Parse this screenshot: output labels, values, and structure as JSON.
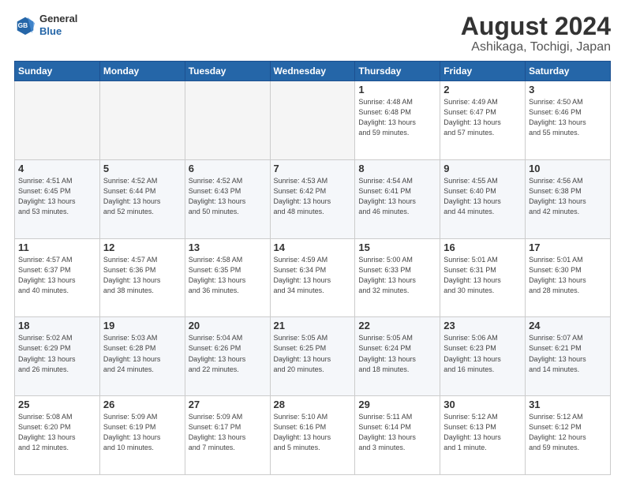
{
  "header": {
    "logo_general": "General",
    "logo_blue": "Blue",
    "title": "August 2024",
    "subtitle": "Ashikaga, Tochigi, Japan"
  },
  "days_of_week": [
    "Sunday",
    "Monday",
    "Tuesday",
    "Wednesday",
    "Thursday",
    "Friday",
    "Saturday"
  ],
  "weeks": [
    [
      {
        "day": "",
        "info": ""
      },
      {
        "day": "",
        "info": ""
      },
      {
        "day": "",
        "info": ""
      },
      {
        "day": "",
        "info": ""
      },
      {
        "day": "1",
        "info": "Sunrise: 4:48 AM\nSunset: 6:48 PM\nDaylight: 13 hours\nand 59 minutes."
      },
      {
        "day": "2",
        "info": "Sunrise: 4:49 AM\nSunset: 6:47 PM\nDaylight: 13 hours\nand 57 minutes."
      },
      {
        "day": "3",
        "info": "Sunrise: 4:50 AM\nSunset: 6:46 PM\nDaylight: 13 hours\nand 55 minutes."
      }
    ],
    [
      {
        "day": "4",
        "info": "Sunrise: 4:51 AM\nSunset: 6:45 PM\nDaylight: 13 hours\nand 53 minutes."
      },
      {
        "day": "5",
        "info": "Sunrise: 4:52 AM\nSunset: 6:44 PM\nDaylight: 13 hours\nand 52 minutes."
      },
      {
        "day": "6",
        "info": "Sunrise: 4:52 AM\nSunset: 6:43 PM\nDaylight: 13 hours\nand 50 minutes."
      },
      {
        "day": "7",
        "info": "Sunrise: 4:53 AM\nSunset: 6:42 PM\nDaylight: 13 hours\nand 48 minutes."
      },
      {
        "day": "8",
        "info": "Sunrise: 4:54 AM\nSunset: 6:41 PM\nDaylight: 13 hours\nand 46 minutes."
      },
      {
        "day": "9",
        "info": "Sunrise: 4:55 AM\nSunset: 6:40 PM\nDaylight: 13 hours\nand 44 minutes."
      },
      {
        "day": "10",
        "info": "Sunrise: 4:56 AM\nSunset: 6:38 PM\nDaylight: 13 hours\nand 42 minutes."
      }
    ],
    [
      {
        "day": "11",
        "info": "Sunrise: 4:57 AM\nSunset: 6:37 PM\nDaylight: 13 hours\nand 40 minutes."
      },
      {
        "day": "12",
        "info": "Sunrise: 4:57 AM\nSunset: 6:36 PM\nDaylight: 13 hours\nand 38 minutes."
      },
      {
        "day": "13",
        "info": "Sunrise: 4:58 AM\nSunset: 6:35 PM\nDaylight: 13 hours\nand 36 minutes."
      },
      {
        "day": "14",
        "info": "Sunrise: 4:59 AM\nSunset: 6:34 PM\nDaylight: 13 hours\nand 34 minutes."
      },
      {
        "day": "15",
        "info": "Sunrise: 5:00 AM\nSunset: 6:33 PM\nDaylight: 13 hours\nand 32 minutes."
      },
      {
        "day": "16",
        "info": "Sunrise: 5:01 AM\nSunset: 6:31 PM\nDaylight: 13 hours\nand 30 minutes."
      },
      {
        "day": "17",
        "info": "Sunrise: 5:01 AM\nSunset: 6:30 PM\nDaylight: 13 hours\nand 28 minutes."
      }
    ],
    [
      {
        "day": "18",
        "info": "Sunrise: 5:02 AM\nSunset: 6:29 PM\nDaylight: 13 hours\nand 26 minutes."
      },
      {
        "day": "19",
        "info": "Sunrise: 5:03 AM\nSunset: 6:28 PM\nDaylight: 13 hours\nand 24 minutes."
      },
      {
        "day": "20",
        "info": "Sunrise: 5:04 AM\nSunset: 6:26 PM\nDaylight: 13 hours\nand 22 minutes."
      },
      {
        "day": "21",
        "info": "Sunrise: 5:05 AM\nSunset: 6:25 PM\nDaylight: 13 hours\nand 20 minutes."
      },
      {
        "day": "22",
        "info": "Sunrise: 5:05 AM\nSunset: 6:24 PM\nDaylight: 13 hours\nand 18 minutes."
      },
      {
        "day": "23",
        "info": "Sunrise: 5:06 AM\nSunset: 6:23 PM\nDaylight: 13 hours\nand 16 minutes."
      },
      {
        "day": "24",
        "info": "Sunrise: 5:07 AM\nSunset: 6:21 PM\nDaylight: 13 hours\nand 14 minutes."
      }
    ],
    [
      {
        "day": "25",
        "info": "Sunrise: 5:08 AM\nSunset: 6:20 PM\nDaylight: 13 hours\nand 12 minutes."
      },
      {
        "day": "26",
        "info": "Sunrise: 5:09 AM\nSunset: 6:19 PM\nDaylight: 13 hours\nand 10 minutes."
      },
      {
        "day": "27",
        "info": "Sunrise: 5:09 AM\nSunset: 6:17 PM\nDaylight: 13 hours\nand 7 minutes."
      },
      {
        "day": "28",
        "info": "Sunrise: 5:10 AM\nSunset: 6:16 PM\nDaylight: 13 hours\nand 5 minutes."
      },
      {
        "day": "29",
        "info": "Sunrise: 5:11 AM\nSunset: 6:14 PM\nDaylight: 13 hours\nand 3 minutes."
      },
      {
        "day": "30",
        "info": "Sunrise: 5:12 AM\nSunset: 6:13 PM\nDaylight: 13 hours\nand 1 minute."
      },
      {
        "day": "31",
        "info": "Sunrise: 5:12 AM\nSunset: 6:12 PM\nDaylight: 12 hours\nand 59 minutes."
      }
    ]
  ]
}
